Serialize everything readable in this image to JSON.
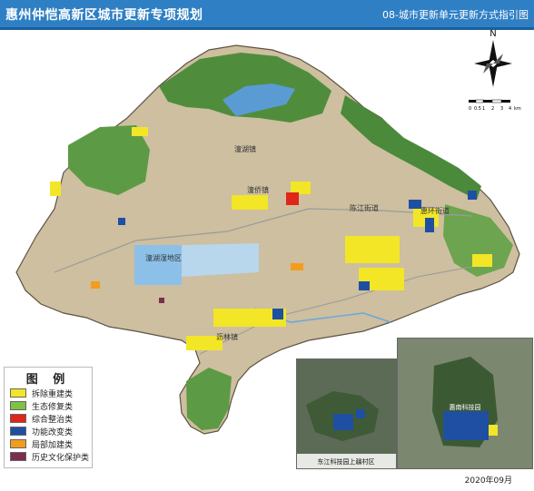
{
  "header": {
    "title_left": "惠州仲恺高新区城市更新专项规划",
    "title_right": "08-城市更新单元更新方式指引图"
  },
  "compass": {
    "north_label": "N"
  },
  "scale": {
    "labels": [
      "0",
      "0.5",
      "1",
      "2",
      "3",
      "4"
    ],
    "unit": "km"
  },
  "places": {
    "p1": "潼湖镇",
    "p2": "潼侨镇",
    "p3": "陈江街道",
    "p4": "惠环街道",
    "p5": "潼湖湿地区",
    "p6": "沥林镇"
  },
  "legend": {
    "title": "图 例",
    "items": [
      {
        "label": "拆除重建类",
        "color": "#f2e627"
      },
      {
        "label": "生态修复类",
        "color": "#7dc242"
      },
      {
        "label": "综合整治类",
        "color": "#e0251b"
      },
      {
        "label": "功能改变类",
        "color": "#1f4fa3"
      },
      {
        "label": "局部加建类",
        "color": "#f39c1f"
      },
      {
        "label": "历史文化保护类",
        "color": "#7a2d4d"
      }
    ]
  },
  "insets": {
    "inset1_label": "东江科技园上疆村区",
    "inset2_label": "惠南科技园"
  },
  "date": "2020年09月"
}
